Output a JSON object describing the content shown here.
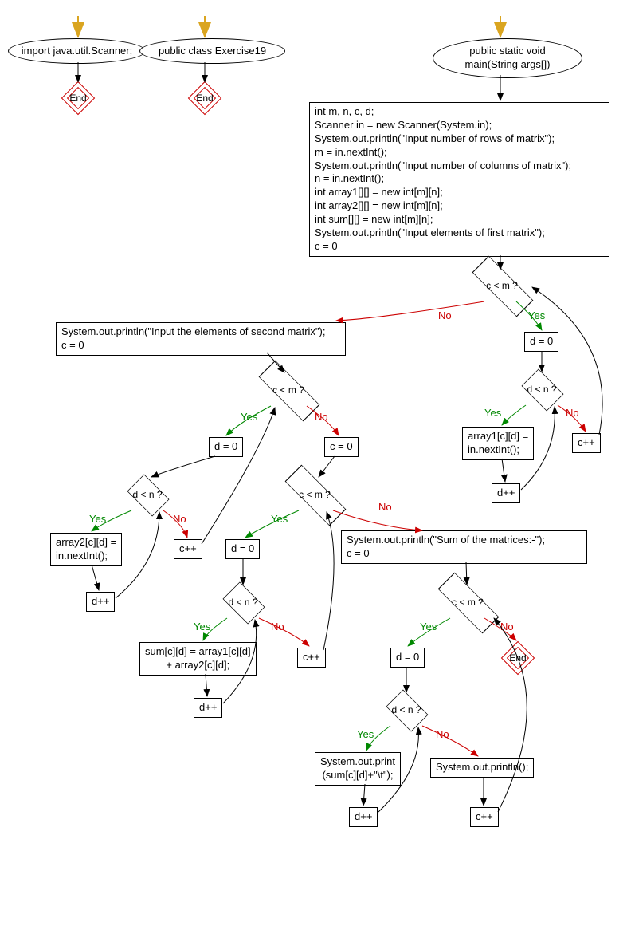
{
  "colors": {
    "arrow_default": "#000000",
    "arrow_yes": "#008000",
    "arrow_no": "#cc0000",
    "arrow_entry": "#daa520"
  },
  "nodes": {
    "import": "import java.util.Scanner;",
    "class_decl": "public class Exercise19",
    "main_sig": "public static void\nmain(String args[])",
    "init_block": "int m, n, c, d;\nScanner in = new Scanner(System.in);\nSystem.out.println(\"Input number of rows of matrix\");\nm = in.nextInt();\nSystem.out.println(\"Input number of columns of matrix\");\nn = in.nextInt();\nint array1[][] = new int[m][n];\nint array2[][] = new int[m][n];\nint sum[][] = new int[m][n];\nSystem.out.println(\"Input elements of first matrix\");\nc = 0",
    "c_lt_m_1": "c < m ?",
    "d0_1": "d = 0",
    "d_lt_n_1": "d < n ?",
    "read_a1": "array1[c][d] =\nin.nextInt();",
    "dpp_1": "d++",
    "cpp_1": "c++",
    "second_prompt": "System.out.println(\"Input the elements of second matrix\");\nc = 0",
    "c_lt_m_2": "c < m ?",
    "d0_2": "d = 0",
    "d_lt_n_2": "d < n ?",
    "read_a2": "array2[c][d] =\nin.nextInt();",
    "dpp_2": "d++",
    "cpp_2_left": "c++",
    "c0_mid": "c = 0",
    "c_lt_m_3": "c < m ?",
    "d0_3": "d = 0",
    "d_lt_n_3": "d < n ?",
    "sum_assign": "sum[c][d] = array1[c][d]\n+ array2[c][d];",
    "dpp_3": "d++",
    "cpp_3": "c++",
    "sum_print_hdr": "System.out.println(\"Sum of the matrices:-\");\nc = 0",
    "c_lt_m_4": "c < m ?",
    "d0_4": "d = 0",
    "d_lt_n_4": "d < n ?",
    "print_cell": "System.out.print\n(sum[c][d]+\"\\t\");",
    "println_row": "System.out.println();",
    "dpp_4": "d++",
    "cpp_4": "c++",
    "end_label": "End"
  },
  "labels": {
    "yes": "Yes",
    "no": "No"
  }
}
